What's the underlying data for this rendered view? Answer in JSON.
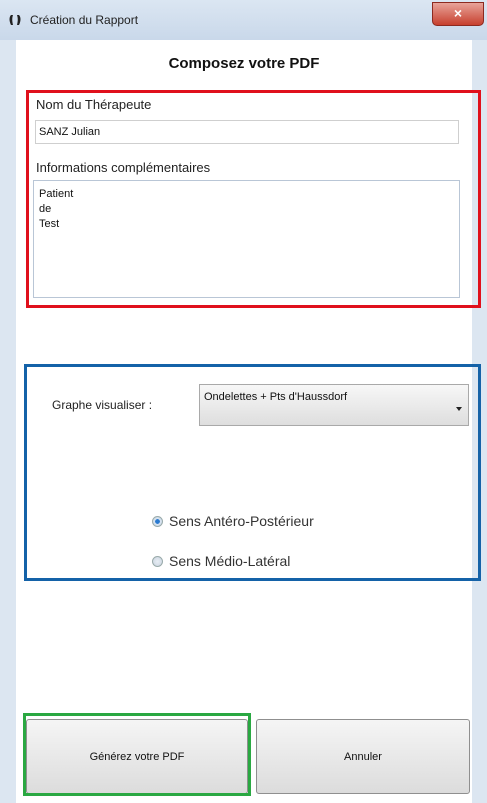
{
  "window": {
    "title": "Création du Rapport",
    "close_label": "×"
  },
  "main": {
    "page_title": "Composez votre PDF"
  },
  "therapist": {
    "label": "Nom du Thérapeute",
    "value": "SANZ Julian"
  },
  "info": {
    "label": "Informations complémentaires",
    "lines": [
      "Patient",
      "de",
      "Test"
    ]
  },
  "graph": {
    "label": "Graphe visualiser :",
    "selected": "Ondelettes + Pts d'Haussdorf"
  },
  "direction": {
    "options": [
      {
        "label": "Sens Antéro-Postérieur",
        "checked": true
      },
      {
        "label": "Sens Médio-Latéral",
        "checked": false
      }
    ]
  },
  "buttons": {
    "generate": "Générez votre PDF",
    "cancel": "Annuler"
  },
  "colors": {
    "red_highlight": "#e0101c",
    "blue_highlight": "#1462a8",
    "green_highlight": "#2aa842"
  }
}
